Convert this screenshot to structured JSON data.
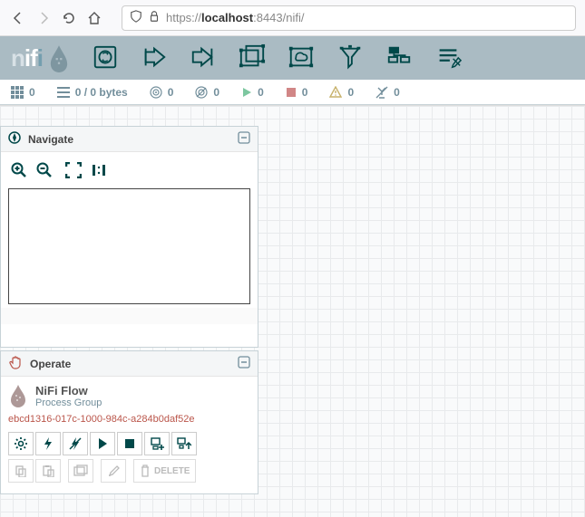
{
  "browser": {
    "url_prefix": "https://",
    "url_host": "localhost",
    "url_port": ":8443",
    "url_path": "/nifi/"
  },
  "logo": {
    "n": "n",
    "i1": "i",
    "f": "f",
    "i2": "i"
  },
  "status": {
    "active_threads": "0",
    "queued": "0 / 0 bytes",
    "transmitting": "0",
    "not_transmitting": "0",
    "running": "0",
    "stopped": "0",
    "invalid": "0",
    "disabled": "0"
  },
  "navigate": {
    "title": "Navigate"
  },
  "operate": {
    "title": "Operate",
    "flow_name": "NiFi Flow",
    "flow_type": "Process Group",
    "flow_id": "ebcd1316-017c-1000-984c-a284b0daf52e",
    "delete_label": "DELETE"
  }
}
